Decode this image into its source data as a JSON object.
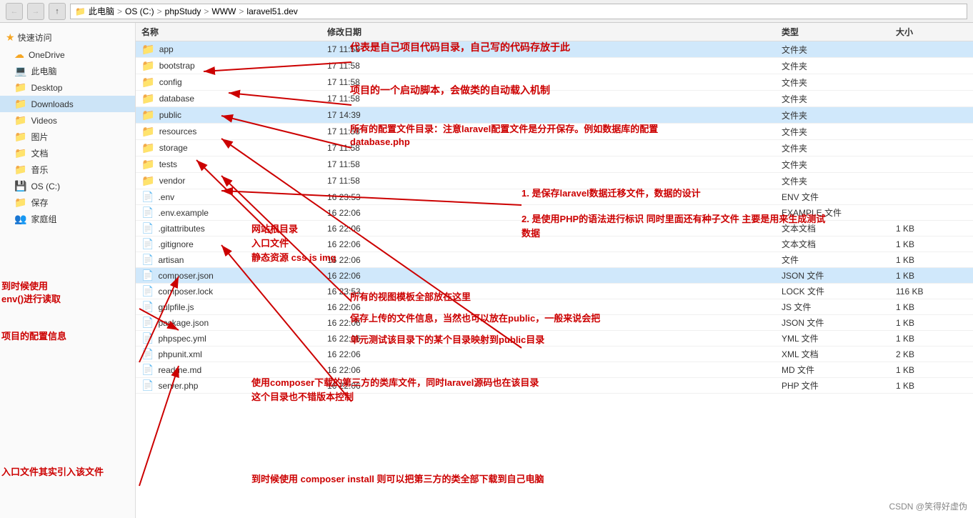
{
  "titlebar": {
    "back_label": "←",
    "forward_label": "→",
    "up_label": "↑",
    "address": [
      "此电脑",
      "OS (C:)",
      "phpStudy",
      "WWW",
      "laravel51.dev"
    ]
  },
  "sidebar": {
    "quick_access_label": "快速访问",
    "items": [
      {
        "label": "OneDrive",
        "icon": "cloud"
      },
      {
        "label": "此电脑",
        "icon": "pc"
      },
      {
        "label": "Desktop",
        "icon": "folder"
      },
      {
        "label": "Downloads",
        "icon": "folder"
      },
      {
        "label": "Videos",
        "icon": "folder"
      },
      {
        "label": "图片",
        "icon": "folder"
      },
      {
        "label": "文档",
        "icon": "folder"
      },
      {
        "label": "音乐",
        "icon": "folder"
      },
      {
        "label": "OS (C:)",
        "icon": "drive"
      },
      {
        "label": "保存",
        "icon": "folder"
      },
      {
        "label": "家庭组",
        "icon": "folder"
      }
    ]
  },
  "file_list": {
    "columns": [
      "名称",
      "修改日期",
      "类型",
      "大小"
    ],
    "files": [
      {
        "name": "app",
        "type": "folder",
        "modified": "17 11:58",
        "kind": "文件夹",
        "size": ""
      },
      {
        "name": "bootstrap",
        "type": "folder",
        "modified": "17 11:58",
        "kind": "文件夹",
        "size": ""
      },
      {
        "name": "config",
        "type": "folder",
        "modified": "17 11:58",
        "kind": "文件夹",
        "size": ""
      },
      {
        "name": "database",
        "type": "folder",
        "modified": "17 11:58",
        "kind": "文件夹",
        "size": ""
      },
      {
        "name": "public",
        "type": "folder",
        "modified": "17 14:39",
        "kind": "文件夹",
        "size": ""
      },
      {
        "name": "resources",
        "type": "folder",
        "modified": "17 11:58",
        "kind": "文件夹",
        "size": ""
      },
      {
        "name": "storage",
        "type": "folder",
        "modified": "17 11:58",
        "kind": "文件夹",
        "size": ""
      },
      {
        "name": "tests",
        "type": "folder",
        "modified": "17 11:58",
        "kind": "文件夹",
        "size": ""
      },
      {
        "name": "vendor",
        "type": "folder",
        "modified": "17 11:58",
        "kind": "文件夹",
        "size": ""
      },
      {
        "name": ".env",
        "type": "file",
        "modified": "16 23:53",
        "kind": "ENV 文件",
        "size": ""
      },
      {
        "name": ".env.example",
        "type": "file",
        "modified": "16 22:06",
        "kind": "EXAMPLE 文件",
        "size": ""
      },
      {
        "name": ".gitattributes",
        "type": "file",
        "modified": "16 22:06",
        "kind": "文本文档",
        "size": "1 KB"
      },
      {
        "name": ".gitignore",
        "type": "file",
        "modified": "16 22:06",
        "kind": "文本文档",
        "size": "1 KB"
      },
      {
        "name": "artisan",
        "type": "file",
        "modified": "16 22:06",
        "kind": "文件",
        "size": "1 KB"
      },
      {
        "name": "composer.json",
        "type": "file",
        "modified": "16 22:06",
        "kind": "JSON 文件",
        "size": "1 KB"
      },
      {
        "name": "composer.lock",
        "type": "file",
        "modified": "16 23:53",
        "kind": "LOCK 文件",
        "size": "116 KB"
      },
      {
        "name": "gulpfile.js",
        "type": "file",
        "modified": "16 22:06",
        "kind": "JS 文件",
        "size": "1 KB"
      },
      {
        "name": "package.json",
        "type": "file",
        "modified": "16 22:06",
        "kind": "JSON 文件",
        "size": "1 KB"
      },
      {
        "name": "phpspec.yml",
        "type": "file",
        "modified": "16 22:06",
        "kind": "YML 文件",
        "size": "1 KB"
      },
      {
        "name": "phpunit.xml",
        "type": "file",
        "modified": "16 22:06",
        "kind": "XML 文档",
        "size": "2 KB"
      },
      {
        "name": "readme.md",
        "type": "file",
        "modified": "16 22:06",
        "kind": "MD 文件",
        "size": "1 KB"
      },
      {
        "name": "server.php",
        "type": "file",
        "modified": "16 22:06",
        "kind": "PHP 文件",
        "size": "1 KB"
      }
    ]
  },
  "annotations": {
    "app_desc": "代表是自己项目代码目录，自己写的代码存放于此",
    "bootstrap_desc": "项目的一个启动脚本，会做类的自动载入机制",
    "config_desc": "所有的配置文件目录：注意laravel配置文件是分开保存。例如数据库的配置 database.php",
    "public_desc": "网站根目录",
    "public_desc2": "入口文件",
    "public_desc3": "静态资源 css js img",
    "storage_desc": "1. 是保存laravel数据迁移文件，数据的设计",
    "database_desc": "2. 是使用PHP的语法进行标识 同时里面还有种子文件 主要是用来生成测试数据",
    "resources_desc": "所有的视图模板全部放在这里",
    "storage_desc2": "保存上传的文件信息，当然也可以放在public，一般来说会把",
    "tests_desc": "单元测试该目录下的某个目录映射到public目录",
    "vendor_desc": "使用composer下载的第三方的类库文件，同时laravel源码也在该目录",
    "vendor_desc2": "这个目录也不错版本控制",
    "env_desc": "到时候使用",
    "env_desc2": "env()进行读取",
    "artisan_desc": "项目的配置信息",
    "composer_json_desc": "入口文件其实引入该文件",
    "composer_install_desc": "到时候使用 composer install 则可以把第三方的类全部下载到自己电脑",
    "csdn": "CSDN @笑得好虚伪"
  }
}
